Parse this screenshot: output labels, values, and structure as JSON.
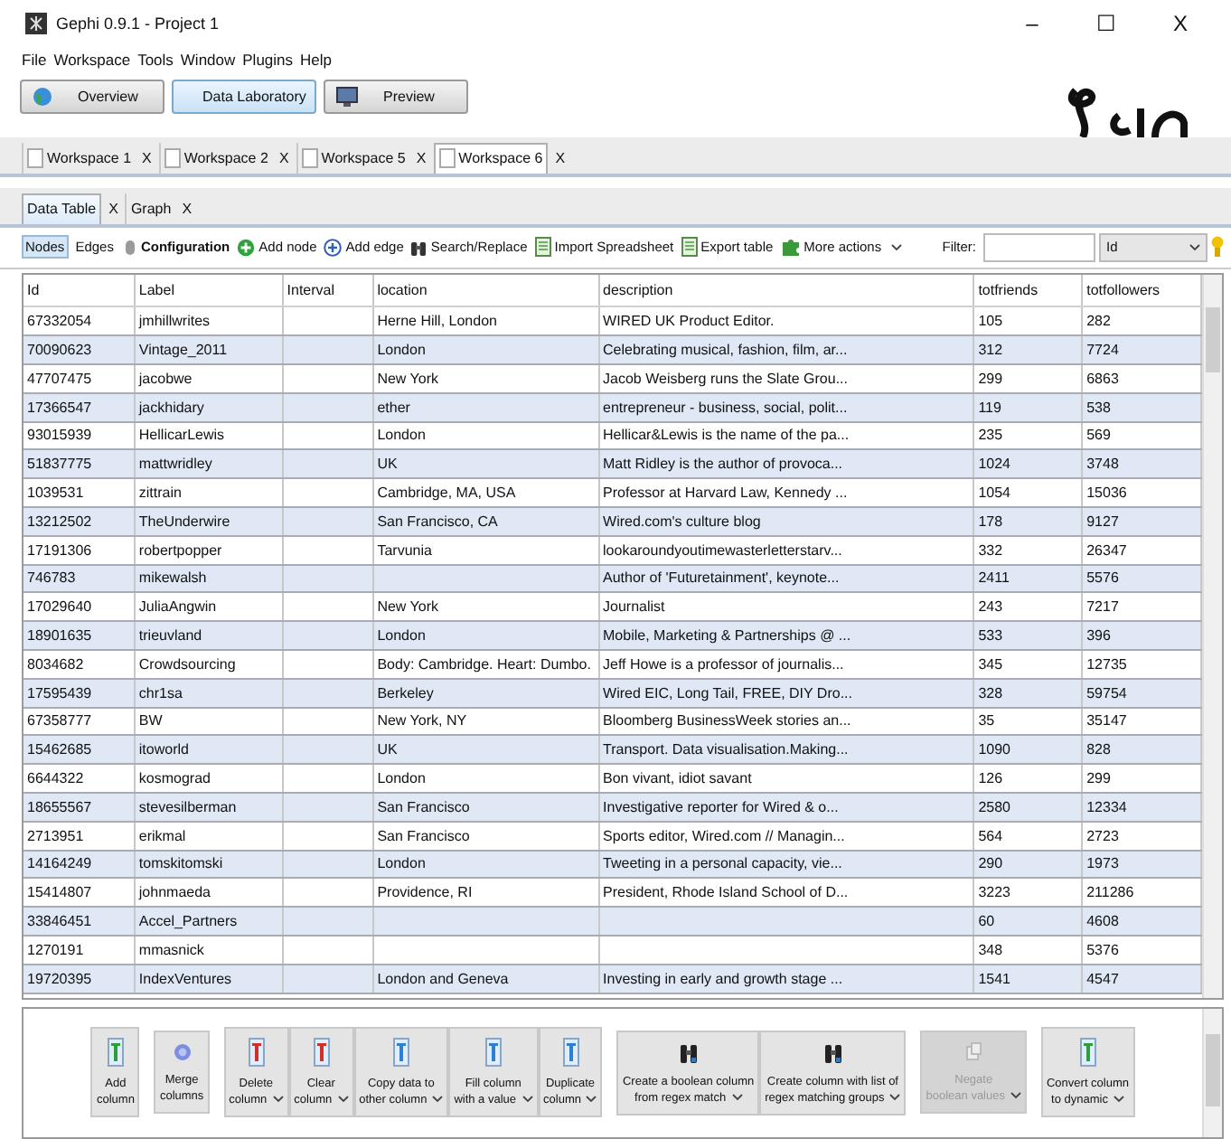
{
  "window": {
    "title": "Gephi 0.9.1 - Project 1",
    "controls": [
      "–",
      "☐",
      "X"
    ]
  },
  "menu": [
    "File",
    "Workspace",
    "Tools",
    "Window",
    "Plugins",
    "Help"
  ],
  "perspectives": [
    {
      "label": "Overview",
      "kind": "globe",
      "selected": false
    },
    {
      "label": "Data Laboratory",
      "kind": "table",
      "selected": true
    },
    {
      "label": "Preview",
      "kind": "monitor",
      "selected": false
    }
  ],
  "workspace_tabs": [
    {
      "label": "Workspace 1",
      "close": "X",
      "selected": false
    },
    {
      "label": "Workspace 2",
      "close": "X",
      "selected": false
    },
    {
      "label": "Workspace 5",
      "close": "X",
      "selected": false
    },
    {
      "label": "Workspace 6",
      "close": "X",
      "selected": true
    }
  ],
  "view_tabs": [
    {
      "label": "Data Table",
      "close": "X",
      "selected": true
    },
    {
      "label": "Graph",
      "close": "X",
      "selected": false
    }
  ],
  "toolbar": {
    "toggles": [
      {
        "label": "Nodes",
        "selected": true
      },
      {
        "label": "Edges",
        "selected": false
      }
    ],
    "actions": [
      {
        "label": "Configuration",
        "kind": "config"
      },
      {
        "label": "Add node",
        "kind": "add"
      },
      {
        "label": "Add edge",
        "kind": "add-edge"
      },
      {
        "label": "Search/Replace",
        "kind": "binoculars"
      },
      {
        "label": "Import Spreadsheet",
        "kind": "sheet"
      },
      {
        "label": "Export table",
        "kind": "sheet"
      },
      {
        "label": "More actions",
        "kind": "puzzle"
      }
    ],
    "filter_label": "Filter:",
    "filter_column": "Id"
  },
  "table": {
    "columns": [
      "Id",
      "Label",
      "Interval",
      "location",
      "description",
      "totfriends",
      "totfollowers"
    ],
    "rows": [
      [
        "67332054",
        "jmhillwrites",
        "",
        "Herne Hill, London",
        "WIRED UK Product Editor.",
        "105",
        "282"
      ],
      [
        "70090623",
        "Vintage_2011",
        "",
        "London",
        "Celebrating musical, fashion, film, ar...",
        "312",
        "7724"
      ],
      [
        "47707475",
        "jacobwe",
        "",
        "New York",
        "Jacob Weisberg runs the Slate Grou...",
        "299",
        "6863"
      ],
      [
        "17366547",
        "jackhidary",
        "",
        "ether",
        "entrepreneur - business, social, polit...",
        "119",
        "538"
      ],
      [
        "93015939",
        "HellicarLewis",
        "",
        "London",
        "Hellicar&Lewis is the name of the pa...",
        "235",
        "569"
      ],
      [
        "51837775",
        "mattwridley",
        "",
        "UK",
        "Matt Ridley is the author of provoca...",
        "1024",
        "3748"
      ],
      [
        "1039531",
        "zittrain",
        "",
        "Cambridge, MA, USA",
        "Professor at Harvard Law, Kennedy ...",
        "1054",
        "15036"
      ],
      [
        "13212502",
        "TheUnderwire",
        "",
        "San Francisco, CA",
        "Wired.com's culture blog",
        "178",
        "9127"
      ],
      [
        "17191306",
        "robertpopper",
        "",
        "Tarvunia",
        "lookaroundyoutimewasterletterstarv...",
        "332",
        "26347"
      ],
      [
        "746783",
        "mikewalsh",
        "",
        "",
        "Author of 'Futuretainment', keynote...",
        "2411",
        "5576"
      ],
      [
        "17029640",
        "JuliaAngwin",
        "",
        "New York",
        "Journalist",
        "243",
        "7217"
      ],
      [
        "18901635",
        "trieuvland",
        "",
        "London",
        "Mobile, Marketing & Partnerships @ ...",
        "533",
        "396"
      ],
      [
        "8034682",
        "Crowdsourcing",
        "",
        "Body: Cambridge. Heart: Dumbo.",
        "Jeff Howe is a professor of journalis...",
        "345",
        "12735"
      ],
      [
        "17595439",
        "chr1sa",
        "",
        "Berkeley",
        "Wired EIC, Long Tail, FREE, DIY Dro...",
        "328",
        "59754"
      ],
      [
        "67358777",
        "BW",
        "",
        "New York, NY",
        "Bloomberg BusinessWeek stories an...",
        "35",
        "35147"
      ],
      [
        "15462685",
        "itoworld",
        "",
        "UK",
        "Transport. Data visualisation.Making...",
        "1090",
        "828"
      ],
      [
        "6644322",
        "kosmograd",
        "",
        "London",
        "Bon vivant, idiot savant",
        "126",
        "299"
      ],
      [
        "18655567",
        "stevesilberman",
        "",
        "San Francisco",
        "Investigative reporter for Wired & o...",
        "2580",
        "12334"
      ],
      [
        "2713951",
        "erikmal",
        "",
        "San Francisco",
        "Sports editor, Wired.com // Managin...",
        "564",
        "2723"
      ],
      [
        "14164249",
        "tomskitomski",
        "",
        "London",
        "Tweeting in a personal capacity, vie...",
        "290",
        "1973"
      ],
      [
        "15414807",
        "johnmaeda",
        "",
        "Providence, RI",
        "President, Rhode Island School of D...",
        "3223",
        "211286"
      ],
      [
        "33846451",
        "Accel_Partners",
        "",
        "",
        "",
        "60",
        "4608"
      ],
      [
        "1270191",
        "mmasnick",
        "",
        "",
        "",
        "348",
        "5376"
      ],
      [
        "19720395",
        "IndexVentures",
        "",
        "London and Geneva",
        "Investing in early and growth stage ...",
        "1541",
        "4547"
      ]
    ]
  },
  "column_actions": [
    [
      {
        "lines": [
          "Add",
          "column"
        ],
        "kind": "add-column",
        "dropdown": false,
        "disabled": false
      }
    ],
    [
      {
        "lines": [
          "Merge",
          "columns"
        ],
        "kind": "merge",
        "dropdown": false,
        "disabled": false
      }
    ],
    [
      {
        "lines": [
          "Delete",
          "column"
        ],
        "kind": "remove-column",
        "dropdown": true,
        "disabled": false
      },
      {
        "lines": [
          "Clear",
          "column"
        ],
        "kind": "remove-column",
        "dropdown": true,
        "disabled": false
      },
      {
        "lines": [
          "Copy data to",
          "other column"
        ],
        "kind": "column",
        "dropdown": true,
        "disabled": false
      },
      {
        "lines": [
          "Fill column",
          "with a value"
        ],
        "kind": "column",
        "dropdown": true,
        "disabled": false
      },
      {
        "lines": [
          "Duplicate",
          "column"
        ],
        "kind": "column",
        "dropdown": true,
        "disabled": false
      }
    ],
    [
      {
        "lines": [
          "Create a boolean column",
          "from regex match"
        ],
        "kind": "binoculars",
        "dropdown": true,
        "disabled": false
      },
      {
        "lines": [
          "Create column with list of",
          "regex matching groups"
        ],
        "kind": "binoculars",
        "dropdown": true,
        "disabled": false
      }
    ],
    [
      {
        "lines": [
          "Negate",
          "boolean values"
        ],
        "kind": "negate",
        "dropdown": true,
        "disabled": true
      }
    ],
    [
      {
        "lines": [
          "Convert column",
          "to dynamic"
        ],
        "kind": "add-column",
        "dropdown": true,
        "disabled": false
      }
    ]
  ]
}
